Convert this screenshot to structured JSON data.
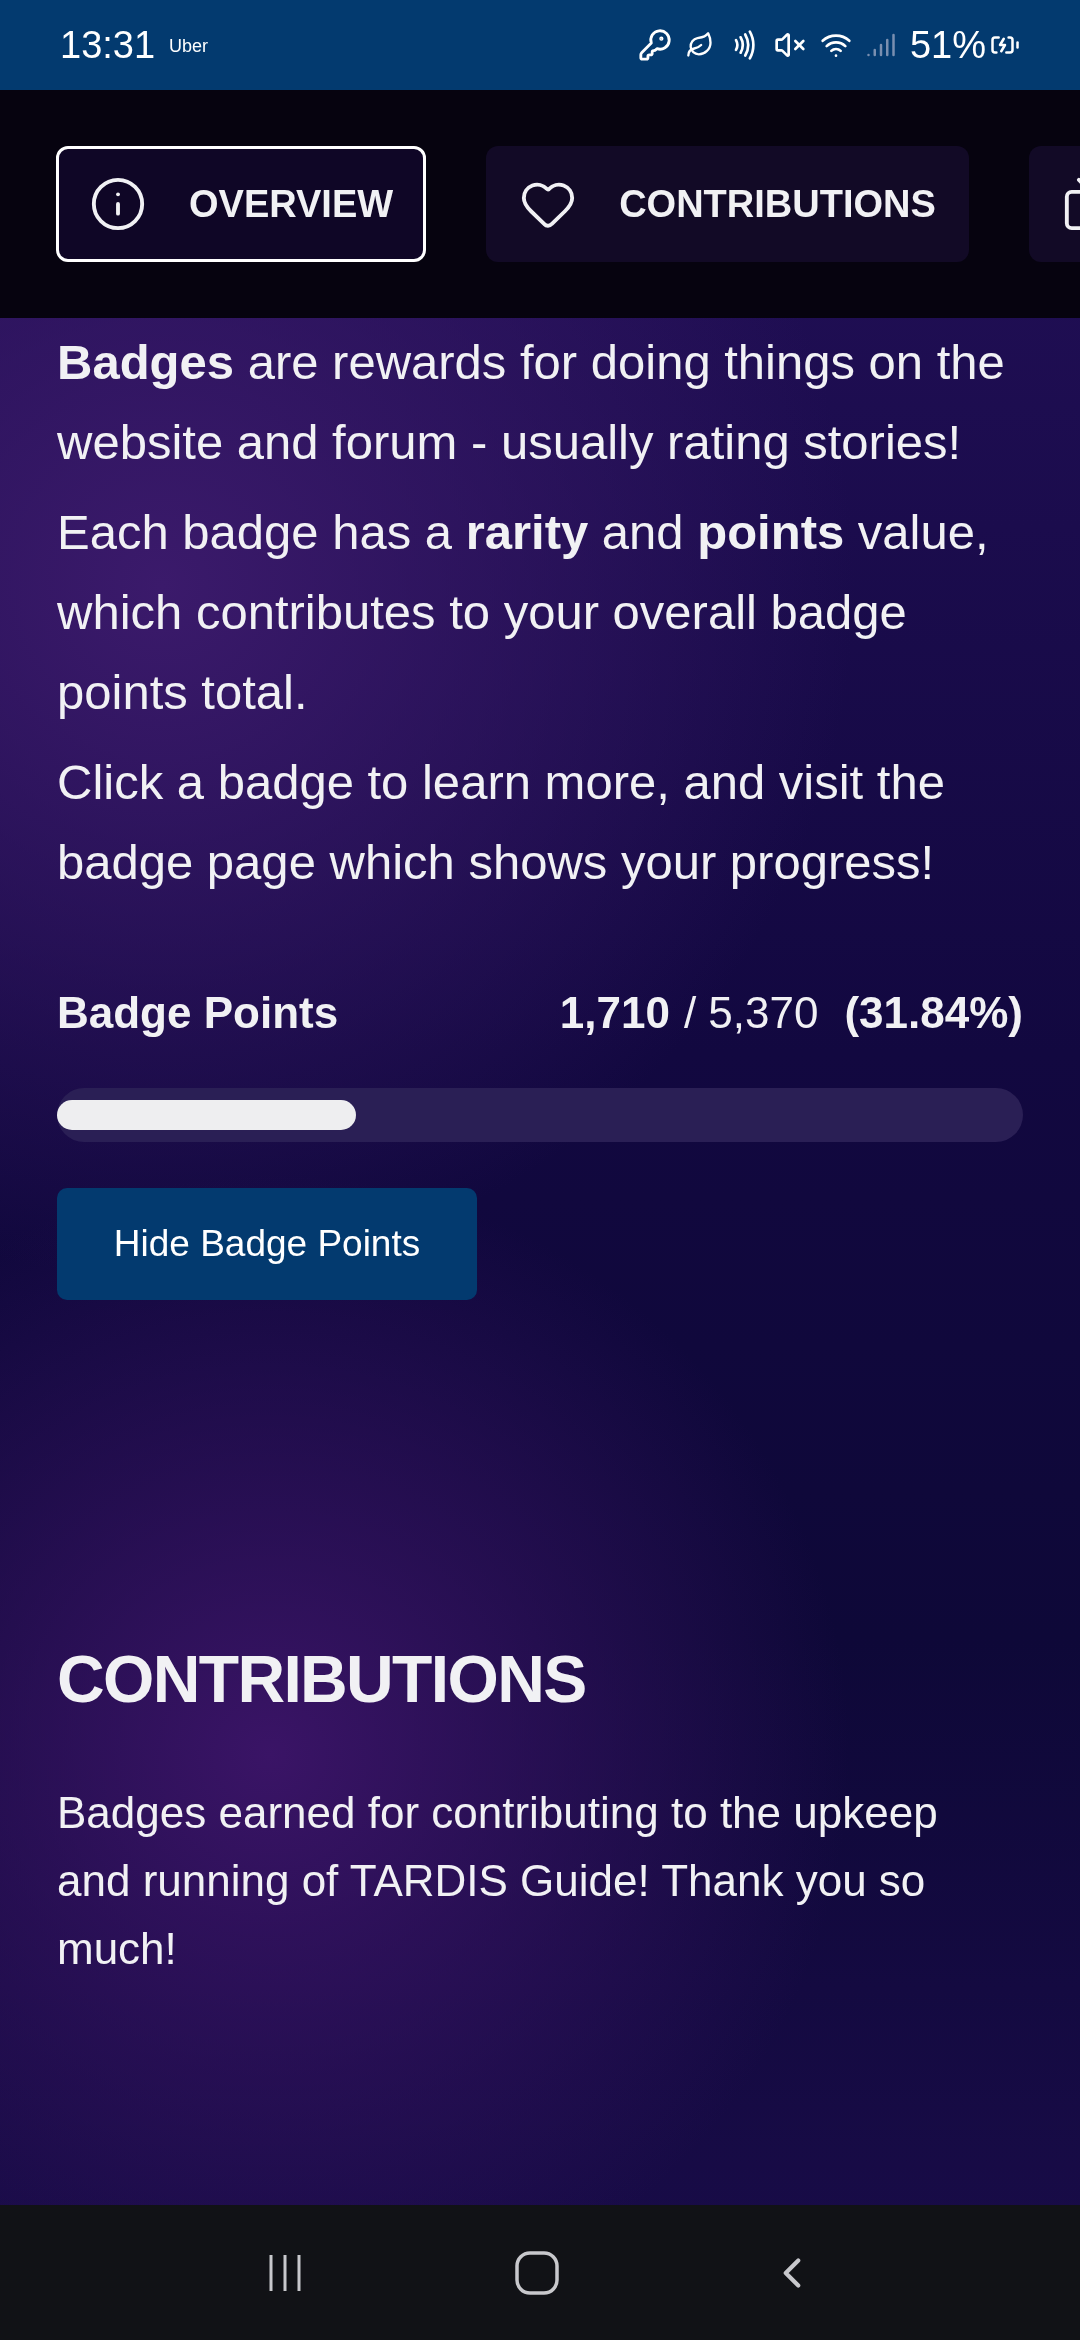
{
  "status_bar": {
    "time": "13:31",
    "notification": "Uber",
    "battery": "51%"
  },
  "tabs": [
    {
      "label": "OVERVIEW",
      "selected": true
    },
    {
      "label": "CONTRIBUTIONS",
      "selected": false
    },
    {
      "selected": false
    }
  ],
  "intro": [
    "**Badges** are rewards for doing things on the website and forum - usually rating stories!",
    "Each badge has a **rarity** and **points** value, which contributes to your overall badge points total.",
    "Click a badge to learn more, and visit the badge page which shows your progress!"
  ],
  "badge_points": {
    "label": "Badge Points",
    "earned": "1,710",
    "total": "/ 5,370",
    "percent": "(31.84%)",
    "level": 0.31
  },
  "hide_button": "Hide Badge Points",
  "section": {
    "title": "CONTRIBUTIONS",
    "description": "Badges earned for contributing to the upkeep and running of TARDIS Guide! Thank you so much!"
  }
}
